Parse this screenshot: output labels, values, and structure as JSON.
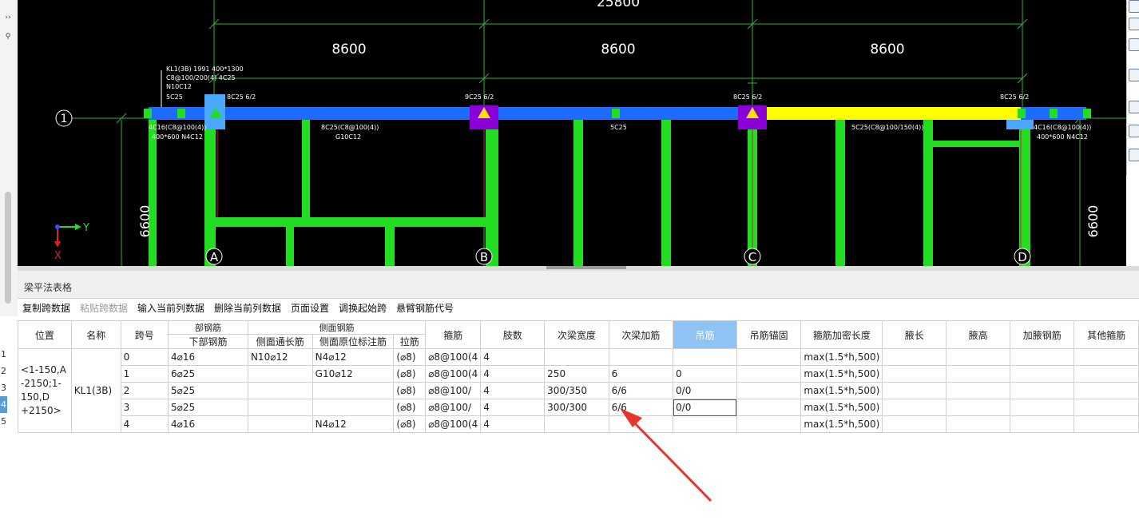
{
  "left_strip": {
    "expand_glyph": "››",
    "search_glyph": "🔍",
    "collapse_glyph": "⊠"
  },
  "cad": {
    "dimensions": {
      "total": "25800",
      "spans": [
        "8600",
        "8600",
        "8600"
      ],
      "height_left": "6600",
      "height_right": "6600"
    },
    "axes": {
      "row_label": "1",
      "col_labels": [
        "A",
        "B",
        "C",
        "D"
      ]
    },
    "beam_annotation": {
      "lines": [
        "KL1(3B) 1991 400*1300",
        "C8@100/200(4) 4C25",
        "N10C12",
        "5C25"
      ]
    },
    "top_rebar_labels": [
      "8C25 6/2",
      "9C25 6/2",
      "8C25 6/2",
      "8C25 6/2"
    ],
    "bottom_labels": [
      {
        "l1": "4C16(C8@100(4))",
        "l2": "400*600 N4C12"
      },
      {
        "l1": "8C25(C8@100(4))",
        "l2": "G10C12"
      },
      {
        "l1": "5C25",
        "l2": ""
      },
      {
        "l1": "5C25(C8@100/150(4))",
        "l2": ""
      },
      {
        "l1": "4C16(C8@100(4))",
        "l2": "400*600 N4C12"
      }
    ],
    "coord": {
      "y": "Y",
      "x": "X"
    },
    "colors": {
      "beam": "#1e6cff",
      "highlight_beam": "#ffff00",
      "column": "#22dd22",
      "support": "#8b00d6",
      "node": "#ffde00",
      "axis_line": "#2fb52f"
    }
  },
  "panel": {
    "title": "梁平法表格",
    "toolbar": [
      {
        "label": "复制跨数据",
        "disabled": false
      },
      {
        "label": "粘贴跨数据",
        "disabled": true
      },
      {
        "label": "输入当前列数据",
        "disabled": false
      },
      {
        "label": "删除当前列数据",
        "disabled": false
      },
      {
        "label": "页面设置",
        "disabled": false
      },
      {
        "label": "调换起始跨",
        "disabled": false
      },
      {
        "label": "悬臂钢筋代号",
        "disabled": false
      }
    ],
    "grid": {
      "group_headers": {
        "bottom": "部钢筋",
        "side": "侧面钢筋"
      },
      "headers": {
        "position": "位置",
        "name": "名称",
        "span": "跨号",
        "bottom_rebar": "下部钢筋",
        "side_long": "侧面通长筋",
        "side_orig": "侧面原位标注筋",
        "tie": "拉筋",
        "stirrup": "箍筋",
        "legs": "肢数",
        "sec_width": "次梁宽度",
        "sec_add": "次梁加筋",
        "hanger": "吊筋",
        "hanger_anchor": "吊筋锚固",
        "stirrup_dense": "箍筋加密长度",
        "haunch_len": "腋长",
        "haunch_h": "腋高",
        "haunch_rebar": "加腋钢筋",
        "other_stirrup": "其他箍筋"
      },
      "merged": {
        "position": "<1-150,A-2150;1-150,D+2150>",
        "position_lines": [
          "<1-150,A",
          "-2150;1-",
          "150,D",
          "+2150>"
        ],
        "name": "KL1(3B)"
      },
      "rows": [
        {
          "rownum": "1",
          "span": "0",
          "bottom": "4⌀16",
          "side_long": "N10⌀12",
          "side_orig": "N4⌀12",
          "tie": "(⌀8)",
          "stirrup": "⌀8@100(4",
          "legs": "4",
          "sec_width": "",
          "sec_add": "",
          "hanger": "",
          "hanger_anchor": "",
          "dense": "max(1.5*h,500)"
        },
        {
          "rownum": "2",
          "span": "1",
          "bottom": "6⌀25",
          "side_long": "",
          "side_orig": "G10⌀12",
          "tie": "(⌀8)",
          "stirrup": "⌀8@100(4",
          "legs": "4",
          "sec_width": "250",
          "sec_add": "6",
          "hanger": "0",
          "hanger_anchor": "",
          "dense": "max(1.5*h,500)"
        },
        {
          "rownum": "3",
          "span": "2",
          "bottom": "5⌀25",
          "side_long": "",
          "side_orig": "",
          "tie": "(⌀8)",
          "stirrup": "⌀8@100/",
          "legs": "4",
          "sec_width": "300/350",
          "sec_add": "6/6",
          "hanger": "0/0",
          "hanger_anchor": "",
          "dense": "max(1.5*h,500)"
        },
        {
          "rownum": "4",
          "span": "3",
          "bottom": "5⌀25",
          "side_long": "",
          "side_orig": "",
          "tie": "(⌀8)",
          "stirrup": "⌀8@100/",
          "legs": "4",
          "sec_width": "300/300",
          "sec_add": "6/6",
          "hanger": "0/0",
          "hanger_anchor": "",
          "dense": "max(1.5*h,500)"
        },
        {
          "rownum": "5",
          "span": "4",
          "bottom": "4⌀16",
          "side_long": "",
          "side_orig": "N4⌀12",
          "tie": "(⌀8)",
          "stirrup": "⌀8@100(4",
          "legs": "4",
          "sec_width": "",
          "sec_add": "",
          "hanger": "",
          "hanger_anchor": "",
          "dense": "max(1.5*h,500)"
        }
      ],
      "selected_row": "4",
      "highlight_column": "吊筋"
    }
  }
}
